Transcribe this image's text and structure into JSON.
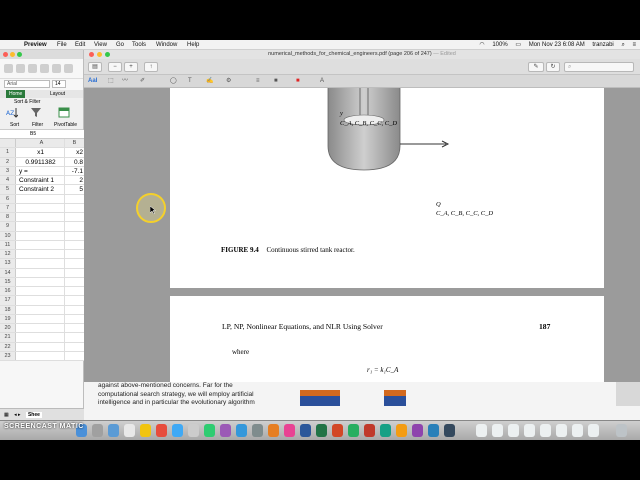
{
  "menubar": {
    "app": "Preview",
    "items": [
      "File",
      "Edit",
      "View",
      "Go",
      "Tools",
      "Window",
      "Help"
    ],
    "battery": "100%",
    "datetime": "Mon Nov 23  6:08 AM",
    "user": "tranzabi"
  },
  "excel": {
    "font_name": "Arial",
    "font_size": "14",
    "tabs": [
      "Home",
      "Layout"
    ],
    "group_label": "Sort & Filter",
    "buttons": [
      "Sort",
      "Filter",
      "PivotTable"
    ],
    "name_box": "B5",
    "columns": [
      "A",
      "B"
    ],
    "rows": [
      {
        "n": "1",
        "a": "x1",
        "b": "x2"
      },
      {
        "n": "2",
        "a": "0.9911382",
        "b": "0.8"
      },
      {
        "n": "3",
        "a": "y =",
        "b": "-7.1"
      },
      {
        "n": "4",
        "a": "Constraint 1",
        "b": "2"
      },
      {
        "n": "5",
        "a": "Constraint 2",
        "b": "5"
      },
      {
        "n": "6",
        "a": "",
        "b": ""
      },
      {
        "n": "7",
        "a": "",
        "b": ""
      },
      {
        "n": "8",
        "a": "",
        "b": ""
      },
      {
        "n": "9",
        "a": "",
        "b": ""
      },
      {
        "n": "10",
        "a": "",
        "b": ""
      },
      {
        "n": "11",
        "a": "",
        "b": ""
      },
      {
        "n": "12",
        "a": "",
        "b": ""
      },
      {
        "n": "13",
        "a": "",
        "b": ""
      },
      {
        "n": "14",
        "a": "",
        "b": ""
      },
      {
        "n": "15",
        "a": "",
        "b": ""
      },
      {
        "n": "16",
        "a": "",
        "b": ""
      },
      {
        "n": "17",
        "a": "",
        "b": ""
      },
      {
        "n": "18",
        "a": "",
        "b": ""
      },
      {
        "n": "19",
        "a": "",
        "b": ""
      },
      {
        "n": "20",
        "a": "",
        "b": ""
      },
      {
        "n": "21",
        "a": "",
        "b": ""
      },
      {
        "n": "22",
        "a": "",
        "b": ""
      },
      {
        "n": "23",
        "a": "",
        "b": ""
      }
    ],
    "sheet_tab": "Shee"
  },
  "preview": {
    "window_title": "numerical_methods_for_chemical_engineers.pdf (page 206 of 247)",
    "edited": "— Edited",
    "markup_label": "AaI",
    "page1": {
      "tank_label_y": "y",
      "tank_label_c": "C_A, C_B, C_C, C_D",
      "outflow_label_q": "Q",
      "outflow_label_c": "C_A, C_B, C_C, C_D",
      "figure_number": "FIGURE 9.4",
      "figure_title": "Continuous stirred tank reactor."
    },
    "page2": {
      "header": "LP, NP, Nonlinear Equations, and NLR Using Solver",
      "page_number": "187",
      "where": "where",
      "equation": "r₁ = k₁C_A"
    }
  },
  "bottom": {
    "line1": "against above-mentioned concerns. Far for the",
    "line2": "computational search strategy, we will employ artificial",
    "line3": "intelligence and in particular the evolutionary algorithm"
  },
  "watermark": "SCREENCAST    MATIC",
  "colors": {
    "close": "#fc5f57",
    "minimize": "#fdbc2e",
    "zoom": "#34c84a",
    "cursor_highlight": "#f4d02b"
  }
}
